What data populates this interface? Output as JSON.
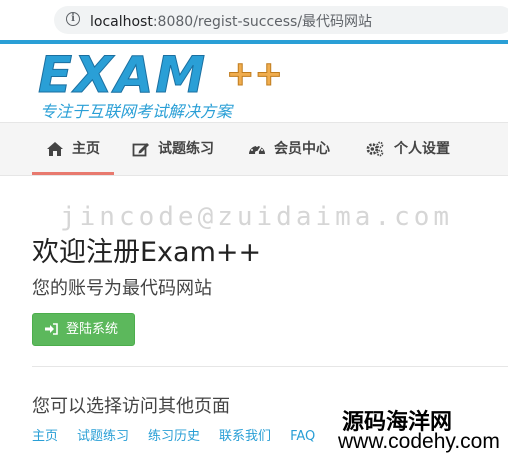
{
  "browser": {
    "url_host": "localhost",
    "url_rest": ":8080/regist-success/最代码网站"
  },
  "logo": {
    "text": "EXAM",
    "plus": "++",
    "slogan": "专注于互联网考试解决方案"
  },
  "nav": {
    "items": [
      {
        "label": "主页",
        "icon": "home-icon"
      },
      {
        "label": "试题练习",
        "icon": "edit-icon"
      },
      {
        "label": "会员中心",
        "icon": "dashboard-icon"
      },
      {
        "label": "个人设置",
        "icon": "gears-icon"
      }
    ]
  },
  "watermark": "jincode@zuidaima.com",
  "main": {
    "heading": "欢迎注册Exam++",
    "account_text": "您的账号为最代码网站",
    "login_button": "登陆系统",
    "other_pages_title": "您可以选择访问其他页面",
    "links": [
      "主页",
      "试题练习",
      "练习历史",
      "联系我们",
      "FAQ"
    ]
  },
  "stamp": {
    "cn": "源码海洋网",
    "url": "www.codehy.com"
  },
  "colors": {
    "accent": "#2a9fd6",
    "button": "#5cb85c",
    "active_underline": "#e8796e"
  }
}
